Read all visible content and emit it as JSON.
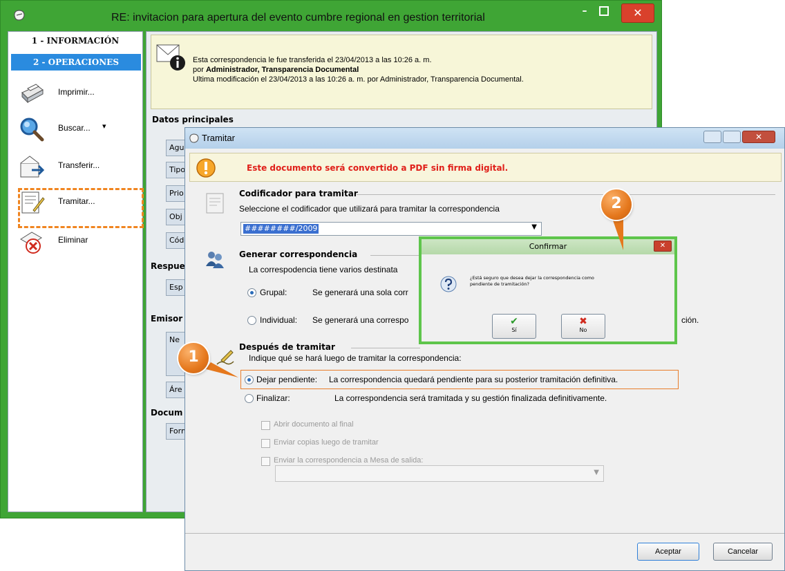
{
  "main_window": {
    "title": "RE: invitacion para apertura del evento cumbre regional en gestion territorial",
    "min_glyph": "–",
    "close_glyph": "✕"
  },
  "left_panel": {
    "tab_info": "1 - INFORMACIÓN",
    "tab_ops": "2 - OPERACIONES",
    "items": [
      {
        "label": "Imprimir...",
        "icon": "printer-icon"
      },
      {
        "label": "Buscar...",
        "icon": "search-icon",
        "dropdown": "▾"
      },
      {
        "label": "Transferir...",
        "icon": "transfer-icon"
      },
      {
        "label": "Tramitar...",
        "icon": "tramitar-icon"
      },
      {
        "label": "Eliminar",
        "icon": "delete-icon"
      }
    ]
  },
  "info_banner": {
    "line1": "Esta correspondencia le fue transferida el 23/04/2013 a las 10:26 a. m.",
    "line2_prefix": "por ",
    "line2_bold": "Administrador, Transparencia Documental",
    "line3": "Ultima modificación el 23/04/2013 a las 10:26 a. m. por Administrador, Transparencia Documental."
  },
  "main_form": {
    "datos_label": "Datos principales",
    "field_stubs": [
      "Agu",
      "Tipo",
      "Prio",
      "Obj",
      "Cód"
    ],
    "respuesta_label": "Respue",
    "respuesta_stub": "Esp",
    "emisor_label": "Emisor",
    "emisor_stubs": [
      "Ne",
      "Áre"
    ],
    "documento_label": "Docum",
    "documento_stub": "Form"
  },
  "tramitar": {
    "title": "Tramitar",
    "close_glyph": "✕",
    "warning": "Este documento será convertido a PDF sin firma digital.",
    "codificador": {
      "title": "Codificador para tramitar",
      "instruction": "Seleccione el codificador que utilizará para tramitar la correspondencia",
      "value": "########/2009",
      "arrow": "▼"
    },
    "generar": {
      "title": "Generar correspondencia",
      "desc": "La correspodencia tiene varios destinata",
      "grupal_label": "Grupal:",
      "grupal_desc": "Se generará una sola corr",
      "individual_label": "Individual:",
      "individual_desc": "Se generará una correspo",
      "individual_tail": "ción."
    },
    "despues": {
      "title": "Después de tramitar",
      "instruction": "Indique qué se hará luego de tramitar la correspondencia:",
      "opt_pendiente_label": "Dejar pendiente:",
      "opt_pendiente_desc": "La correspondencia quedará pendiente para su posterior tramitación definitiva.",
      "opt_finalizar_label": "Finalizar:",
      "opt_finalizar_desc": "La correspondencia será tramitada y su gestión finalizada definitivamente.",
      "chk_abrir": "Abrir documento al final",
      "chk_copias": "Enviar copias luego de tramitar",
      "chk_mesa": "Enviar la correspondencia a Mesa de salida:",
      "mesa_arrow": "▼"
    },
    "btn_aceptar": "Aceptar",
    "btn_cancelar": "Cancelar"
  },
  "confirmar": {
    "title": "Confirmar",
    "close_glyph": "✕",
    "msg_line1": "¿Está seguro que desea dejar la correspondencia como",
    "msg_line2": "pendiente de tramitación?",
    "yes_mark": "✔",
    "yes_label": "Sí",
    "no_mark": "✖",
    "no_label": "No"
  },
  "callouts": {
    "one": "1",
    "two": "2"
  },
  "colors": {
    "window_green": "#3fa535",
    "accent_orange": "#e87c2a",
    "ops_tab_blue": "#2a8bdf",
    "warning_red": "#e0201a"
  }
}
